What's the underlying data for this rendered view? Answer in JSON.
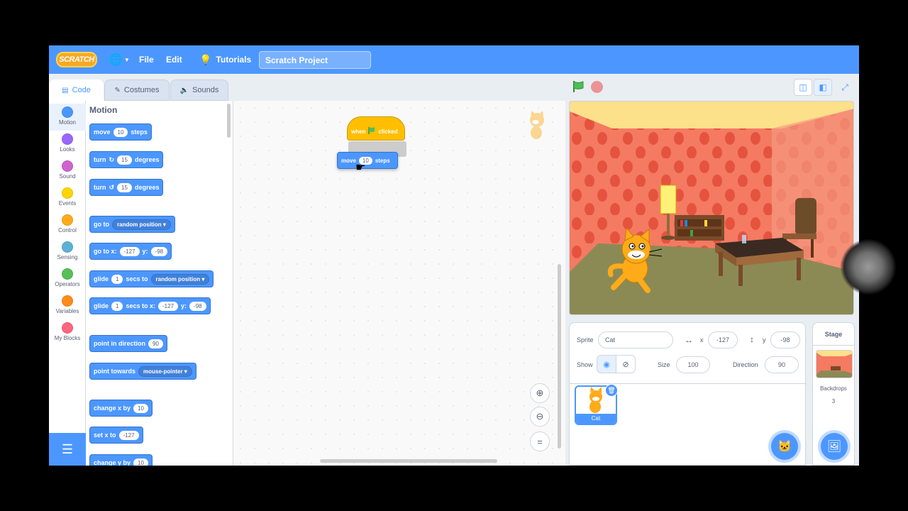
{
  "menubar": {
    "logo": "SCRATCH",
    "file": "File",
    "edit": "Edit",
    "tutorials": "Tutorials",
    "project_title": "Scratch Project"
  },
  "tabs": {
    "code": "Code",
    "costumes": "Costumes",
    "sounds": "Sounds"
  },
  "categories": [
    {
      "label": "Motion",
      "color": "#4c97ff"
    },
    {
      "label": "Looks",
      "color": "#9966ff"
    },
    {
      "label": "Sound",
      "color": "#cf63cf"
    },
    {
      "label": "Events",
      "color": "#ffd500"
    },
    {
      "label": "Control",
      "color": "#ffab19"
    },
    {
      "label": "Sensing",
      "color": "#5cb1d6"
    },
    {
      "label": "Operators",
      "color": "#59c059"
    },
    {
      "label": "Variables",
      "color": "#ff8c1a"
    },
    {
      "label": "My Blocks",
      "color": "#ff6680"
    }
  ],
  "palette": {
    "title": "Motion",
    "move": {
      "a": "move",
      "v": "10",
      "b": "steps"
    },
    "turn_right": {
      "a": "turn",
      "v": "15",
      "b": "degrees"
    },
    "turn_left": {
      "a": "turn",
      "v": "15",
      "b": "degrees"
    },
    "goto": {
      "a": "go to",
      "d": "random position"
    },
    "goto_xy": {
      "a": "go to x:",
      "x": "-127",
      "b": "y:",
      "y": "-98"
    },
    "glide_to": {
      "a": "glide",
      "v": "1",
      "b": "secs to",
      "d": "random position"
    },
    "glide_xy": {
      "a": "glide",
      "v": "1",
      "b": "secs to x:",
      "x": "-127",
      "c": "y:",
      "y": "-98"
    },
    "point_dir": {
      "a": "point in direction",
      "v": "90"
    },
    "point_towards": {
      "a": "point towards",
      "d": "mouse-pointer"
    },
    "change_x": {
      "a": "change x by",
      "v": "10"
    },
    "set_x": {
      "a": "set x to",
      "v": "-127"
    },
    "change_y": {
      "a": "change y by",
      "v": "10"
    }
  },
  "script": {
    "hat": {
      "a": "when",
      "b": "clicked"
    },
    "move": {
      "a": "move",
      "v": "10",
      "b": "steps"
    }
  },
  "sprite_info": {
    "sprite_label": "Sprite",
    "sprite_name": "Cat",
    "x_label": "x",
    "x": "-127",
    "y_label": "y",
    "y": "-98",
    "show_label": "Show",
    "size_label": "Size",
    "size": "100",
    "direction_label": "Direction",
    "direction": "90"
  },
  "sprite_tile": {
    "name": "Cat"
  },
  "stage_pane": {
    "title": "Stage",
    "backdrops_label": "Backdrops",
    "backdrops_count": "3"
  },
  "colors": {
    "menubar": "#4c97ff",
    "motion": "#4c97ff",
    "events": "#ffbf00"
  }
}
